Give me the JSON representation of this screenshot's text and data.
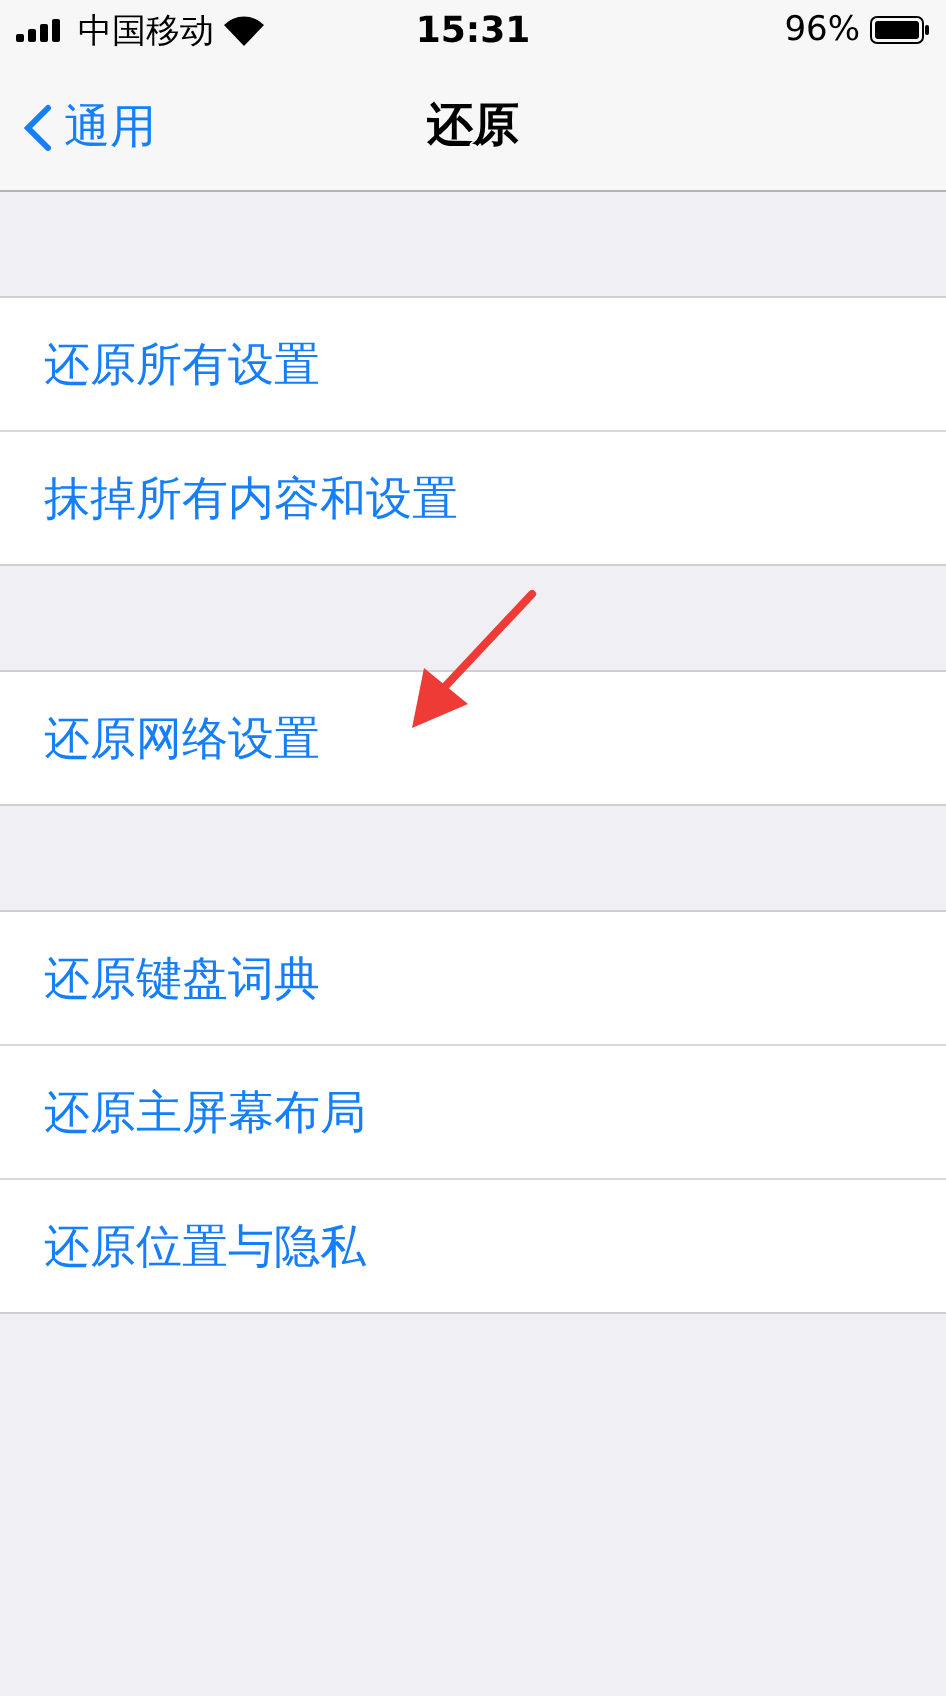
{
  "status_bar": {
    "carrier": "中国移动",
    "time": "15:31",
    "battery": "96%"
  },
  "nav": {
    "back": "通用",
    "title": "还原"
  },
  "groups": [
    {
      "items": [
        "还原所有设置",
        "抹掉所有内容和设置"
      ]
    },
    {
      "items": [
        "还原网络设置"
      ]
    },
    {
      "items": [
        "还原键盘词典",
        "还原主屏幕布局",
        "还原位置与隐私"
      ]
    }
  ]
}
